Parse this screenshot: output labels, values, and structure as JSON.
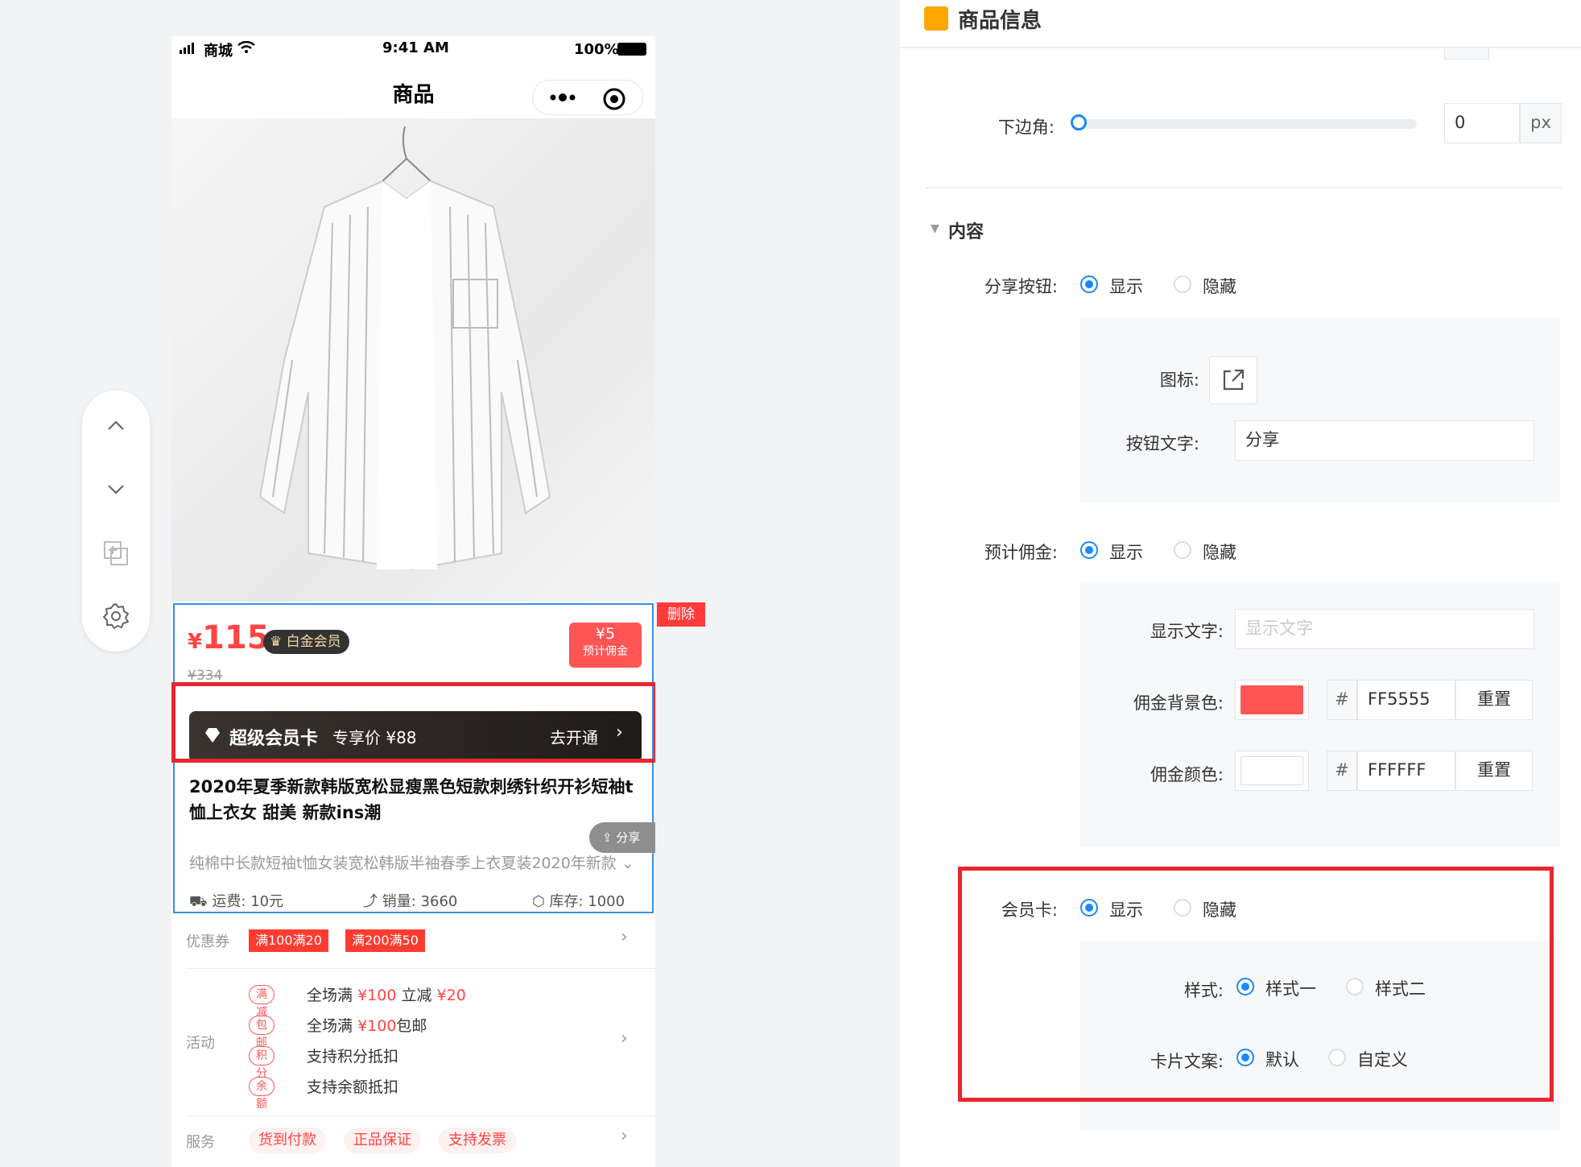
{
  "phone": {
    "status_carrier": "商城",
    "status_time": "9:41 AM",
    "status_battery": "100%",
    "nav_title": "商品",
    "price_currency": "¥",
    "price": "115",
    "vip_badge": "白金会员",
    "original_price": "¥334",
    "commission_value": "¥5",
    "commission_label": "预计佣金",
    "delete_label": "删除",
    "vip_card_title": "超级会员卡",
    "vip_card_price": "专享价 ¥88",
    "vip_card_action": "去开通",
    "product_title": "2020年夏季新款韩版宽松显瘦黑色短款刺绣针织开衫短袖t恤上衣女 甜美 新款ins潮",
    "share_label": "分享",
    "product_subtitle": "纯棉中长款短袖t恤女装宽松韩版半袖春季上衣夏装2020年新款",
    "shipping_label": "运费:",
    "shipping_value": "10元",
    "sales_label": "销量:",
    "sales_value": "3660",
    "stock_label": "库存:",
    "stock_value": "1000",
    "coupon_label": "优惠券",
    "coupons": [
      "满100满20",
      "满200满50"
    ],
    "activity_label": "活动",
    "activities": [
      {
        "tag": "满减",
        "text_a": "全场满",
        "price_a": "¥100",
        "text_b": "立减",
        "price_b": "¥20",
        "text_c": ""
      },
      {
        "tag": "包邮",
        "text_a": "全场满",
        "price_a": "¥100",
        "text_b": "包邮",
        "price_b": "",
        "text_c": ""
      },
      {
        "tag": "积分",
        "text_a": "支持积分抵扣",
        "price_a": "",
        "text_b": "",
        "price_b": "",
        "text_c": ""
      },
      {
        "tag": "余额",
        "text_a": "支持余额抵扣",
        "price_a": "",
        "text_b": "",
        "price_b": "",
        "text_c": ""
      }
    ],
    "service_label": "服务",
    "services": [
      "货到付款",
      "正品保证",
      "支持发票"
    ]
  },
  "panel": {
    "title": "商品信息",
    "bottom_corner_label": "下边角:",
    "bottom_corner_value": "0",
    "bottom_corner_unit": "px",
    "bottom_corner_level": 0,
    "section_content": "内容",
    "share_btn_label": "分享按钮:",
    "show": "显示",
    "hide": "隐藏",
    "icon_label": "图标:",
    "btn_text_label": "按钮文字:",
    "btn_text_value": "分享",
    "commission_label": "预计佣金:",
    "display_text_label": "显示文字:",
    "display_text_placeholder": "显示文字",
    "commission_bg_label": "佣金背景色:",
    "commission_bg_hex": "FF5555",
    "commission_color_label": "佣金颜色:",
    "commission_color_hex": "FFFFFF",
    "hash": "#",
    "reset": "重置",
    "member_card_label": "会员卡:",
    "style_label": "样式:",
    "style_one": "样式一",
    "style_two": "样式二",
    "card_copy_label": "卡片文案:",
    "copy_default": "默认",
    "copy_custom": "自定义"
  },
  "colors": {
    "accent": "#1989fa",
    "commission_bg": "#FF5555",
    "commission_fg": "#FFFFFF",
    "highlight": "#e8262f"
  }
}
